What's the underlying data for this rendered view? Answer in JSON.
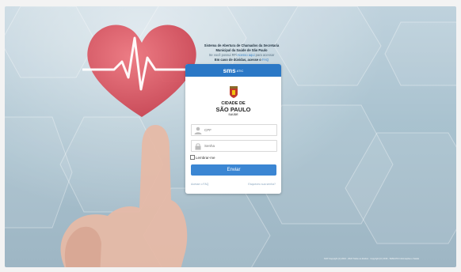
{
  "intro": {
    "line1": "Sistema de Abertura de Chamados da Secretaria",
    "line2": "Municipal da Saúde de São Paulo",
    "line3_prefix": "Se você possui RF/",
    "line3_link": "Acesso aqui",
    "line3_suffix": " para acessar",
    "line4_prefix": "Em caso de dúvidas, acesse o ",
    "line4_link": "FAQ"
  },
  "panel": {
    "logo": "sms",
    "logo_sup": "ATIC",
    "city_line1": "CIDADE DE",
    "city_line2": "SÃO PAULO",
    "city_line3": "SAÚDE"
  },
  "form": {
    "user_placeholder": "CPF",
    "password_placeholder": "Senha",
    "remember_label": "Lembrar-me",
    "submit_label": "Enviar",
    "faq_link": "Acesse o FAQ",
    "forgot_link": "Esqueceu sua senha?"
  },
  "footer": {
    "text": "SCP Copyright (C) 2016 - 2022 Todos os direitos · Copyright (C) 2016 - SMS/ATIC Informações e Saúde"
  },
  "colors": {
    "header_blue": "#2b78c6",
    "button_blue": "#3b86d3",
    "heart_red": "#d9404e"
  }
}
